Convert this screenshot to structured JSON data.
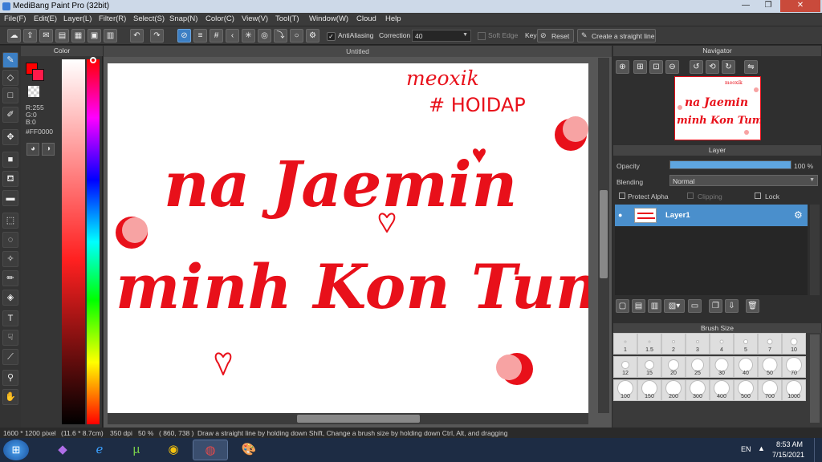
{
  "titlebar": {
    "title": "MediBang Paint Pro (32bit)"
  },
  "menu": [
    "File(F)",
    "Edit(E)",
    "Layer(L)",
    "Filter(R)",
    "Select(S)",
    "Snap(N)",
    "Color(C)",
    "View(V)",
    "Tool(T)",
    "Window(W)",
    "Cloud",
    "Help"
  ],
  "toolbar": {
    "antialiasing_label": "AntiAliasing",
    "correction_label": "Correction",
    "correction_value": "40",
    "softedge_label": "Soft Edge",
    "key_label": "Key",
    "reset_label": "Reset",
    "straight_line_label": "Create a straight line"
  },
  "color_panel": {
    "title": "Color",
    "r": "R:255",
    "g": "G:0",
    "b": "B:0",
    "hex": "#FF0000",
    "primary_color": "#ff0000",
    "secondary_color": "#ff1a4a"
  },
  "canvas": {
    "tab_title": "Untitled",
    "lettering": [
      "meoxik",
      "# HOIDAP",
      "na Jaemin",
      "minh Kon Tum"
    ]
  },
  "navigator": {
    "title": "Navigator"
  },
  "layer_panel": {
    "title": "Layer",
    "opacity_label": "Opacity",
    "opacity_value": "100 %",
    "opacity_fraction": 1.0,
    "blending_label": "Blending",
    "blending_value": "Normal",
    "protect_alpha_label": "Protect Alpha",
    "clipping_label": "Clipping",
    "lock_label": "Lock",
    "layer_name": "Layer1"
  },
  "brush_panel": {
    "title": "Brush Size",
    "rows": [
      [
        "1",
        "1.5",
        "2",
        "3",
        "4",
        "5",
        "7",
        "10"
      ],
      [
        "12",
        "15",
        "20",
        "25",
        "30",
        "40",
        "50",
        "70"
      ],
      [
        "100",
        "150",
        "200",
        "300",
        "400",
        "500",
        "700",
        "1000"
      ]
    ]
  },
  "statusbar": {
    "size": "1600 * 1200 pixel",
    "physical": "(11.6 * 8.7cm)",
    "dpi": "350 dpi",
    "zoom": "50 %",
    "coords": "( 860, 738 )",
    "hint": "Draw a straight line by holding down Shift, Change a brush size by holding down Ctrl, Alt, and dragging"
  },
  "taskbar": {
    "lang": "EN",
    "time": "8:53 AM",
    "date": "7/15/2021"
  }
}
